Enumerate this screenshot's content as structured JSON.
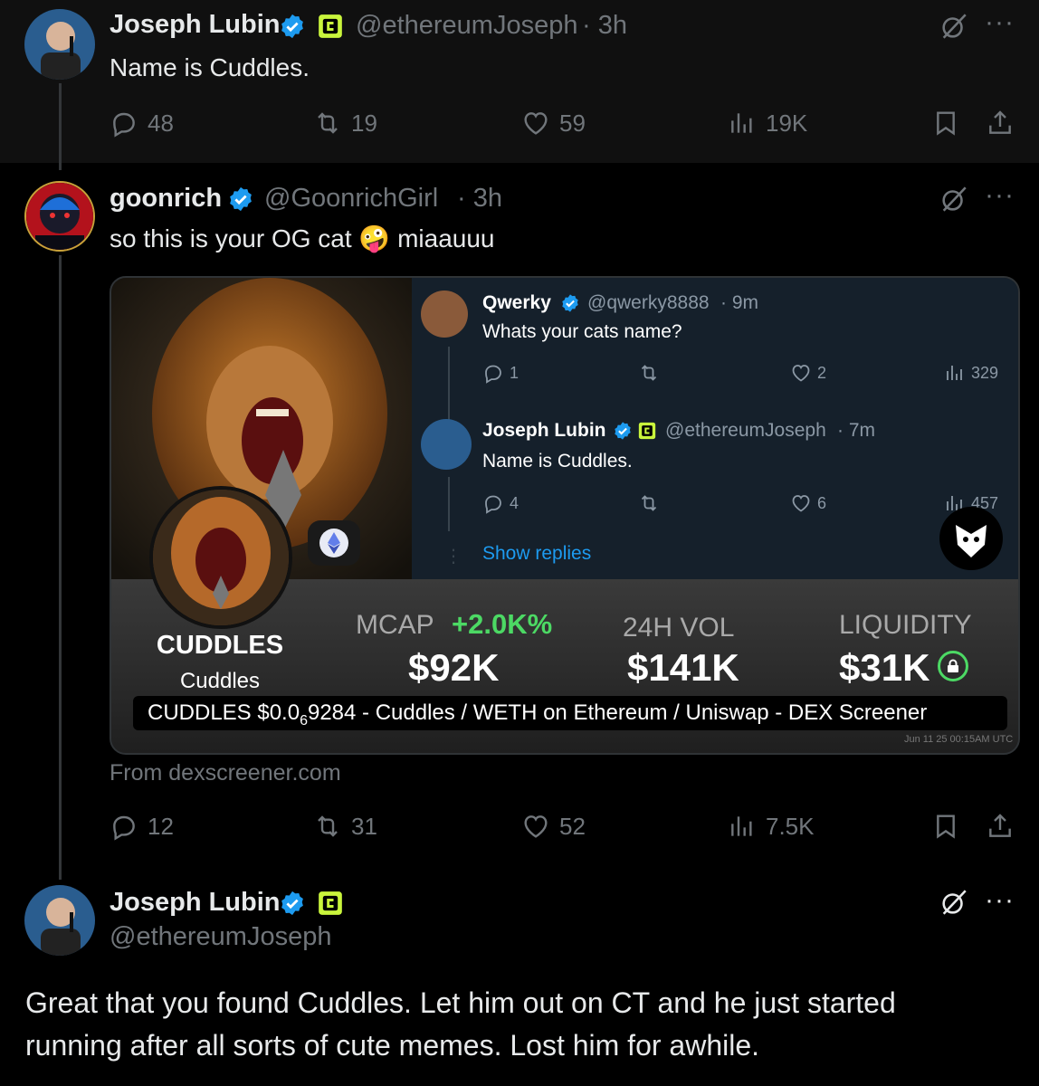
{
  "tweet1": {
    "name": "Joseph Lubin",
    "handle": "@ethereumJoseph",
    "time": "· 3h",
    "text": "Name is Cuddles.",
    "stats": {
      "replies": "48",
      "retweets": "19",
      "likes": "59",
      "views": "19K"
    }
  },
  "tweet2": {
    "name": "goonrich",
    "handle": "@GoonrichGirl",
    "time": "· 3h",
    "text_before_emoji": "so this is your OG cat",
    "emoji": "🤪",
    "text_after_emoji": "miaauuu",
    "card": {
      "embed": {
        "t1": {
          "name": "Qwerky",
          "handle": "@qwerky8888",
          "time": "· 9m",
          "text": "Whats your cats name?",
          "replies": "1",
          "likes": "2",
          "views": "329"
        },
        "t2": {
          "name": "Joseph Lubin",
          "handle": "@ethereumJoseph",
          "time": "· 7m",
          "text": "Name is Cuddles.",
          "replies": "4",
          "likes": "6",
          "views": "457"
        },
        "show_replies": "Show replies"
      },
      "token": {
        "symbol": "CUDDLES",
        "name": "Cuddles"
      },
      "mcap_label": "MCAP",
      "mcap_change": "+2.0K%",
      "mcap_value": "$92K",
      "vol_label": "24H VOL",
      "vol_value": "$141K",
      "liq_label": "LIQUIDITY",
      "liq_value": "$31K",
      "caption_pre": "CUDDLES $0.0",
      "caption_sub": "6",
      "caption_post": "9284 - Cuddles / WETH on Ethereum / Uniswap - DEX Screener",
      "timestamp": "Jun 11 25 00:15AM UTC"
    },
    "source": "From dexscreener.com",
    "stats": {
      "replies": "12",
      "retweets": "31",
      "likes": "52",
      "views": "7.5K"
    }
  },
  "tweet3": {
    "name": "Joseph Lubin",
    "handle": "@ethereumJoseph",
    "text_line1": "Great that you found Cuddles.  Let him out on CT and he just started",
    "text_line2": "running after all sorts of cute memes.  Lost him for awhile."
  },
  "colors": {
    "background": "#000000",
    "verified": "#1d9bf0",
    "gold_badge": "#c9f53c",
    "positive": "#4cd964",
    "muted": "#71767b"
  }
}
